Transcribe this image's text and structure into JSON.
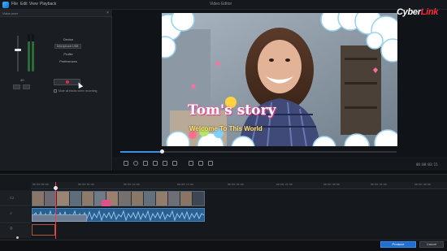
{
  "titlebar": {
    "menus": [
      "File",
      "Edit",
      "View",
      "Playback"
    ],
    "window_title": "Video Editor",
    "brand": "CyberLink"
  },
  "record_panel": {
    "header": "Voice-over",
    "close": "×",
    "volume_value": "40",
    "device_label": "Device",
    "device_value": "Microphone USB",
    "profile_label": "Profile",
    "preferences_label": "Preferences",
    "mute_label": "Mute all tracks when recording",
    "record_color": "#e8283a"
  },
  "preview": {
    "video_title": "Tom's story",
    "video_subtitle": "Welcome To This World",
    "progress": 0.15,
    "timecode": "00:00:03:15"
  },
  "timeline": {
    "ticks": [
      "00:00:00:00",
      "00:00:05:00",
      "00:00:10:00",
      "00:00:15:00",
      "00:00:20:00",
      "00:00:25:00",
      "00:00:30:00",
      "00:00:35:00",
      "00:00:40:00",
      "00:00:45:00"
    ]
  },
  "footer": {
    "produce": "Produce",
    "cancel": "Cancel"
  }
}
